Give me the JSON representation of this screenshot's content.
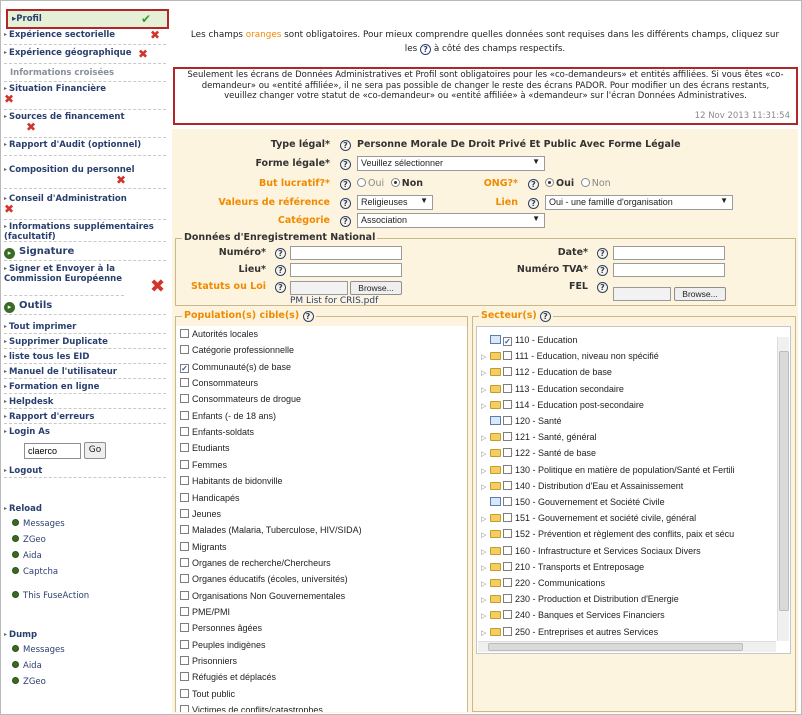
{
  "sidebar": {
    "profil": "Profil",
    "exp_sect": "Expérience sectorielle",
    "exp_geo": "Expérience géographique",
    "info_croisees": "Informations croisées",
    "situation_fin": "Situation Financière",
    "sources_fin": "Sources de financement",
    "rapport_audit": "Rapport d'Audit (optionnel)",
    "composition": "Composition du personnel",
    "conseil": "Conseil d'Administration",
    "info_supp": "Informations supplémentaires (facultatif)",
    "signature": "Signature",
    "signer": "Signer et Envoyer à la Commission Européenne",
    "outils": "Outils",
    "tout_imprimer": "Tout imprimer",
    "supprimer_dup": "Supprimer Duplicate",
    "liste_eid": "liste tous les EID",
    "manuel": "Manuel de l'utilisateur",
    "formation": "Formation en ligne",
    "helpdesk": "Helpdesk",
    "rapport_erreurs": "Rapport d'erreurs",
    "login_as": "Login As",
    "login_value": "claerco",
    "go": "Go",
    "logout": "Logout",
    "reload": "Reload",
    "reload_items": [
      "Messages",
      "ZGeo",
      "Aida",
      "Captcha"
    ],
    "this_fuseaction": "This FuseAction",
    "dump": "Dump",
    "dump_items": [
      "Messages",
      "Aida",
      "ZGeo"
    ]
  },
  "top_info": {
    "pre": "Les champs ",
    "orange": "oranges",
    "post": " sont obligatoires. Pour mieux comprendre quelles données sont requises dans les différents champs, cliquez sur",
    "line2_a": "les",
    "line2_b": "à côté des champs respectifs."
  },
  "warning": {
    "text": "Seulement les écrans de Données Administratives et Profil sont obligatoires pour les «co-demandeurs» et entités affiliées. Si vous êtes «co-demandeur» ou «entité affiliée», il ne sera pas possible de changer le reste des écrans PADOR. Pour modifier un des écrans restants, veuillez changer votre statut de «co-demandeur» ou «entité affiliée» à «demandeur» sur l'écran Données Administratives.",
    "date": "12 Nov 2013 11:31:54"
  },
  "form": {
    "type_legal_label": "Type légal*",
    "type_legal_value": "Personne Morale De Droit Privé Et Public Avec Forme Légale",
    "forme_legale_label": "Forme légale*",
    "forme_legale_value": "Veuillez sélectionner",
    "but_lucratif_label": "But lucratif?*",
    "oui": "Oui",
    "non": "Non",
    "ong_label": "ONG?*",
    "valeurs_label": "Valeurs de référence",
    "valeurs_value": "Religieuses",
    "lien_label": "Lien",
    "lien_value": "Oui - une famille d'organisation",
    "categorie_label": "Catégorie",
    "categorie_value": "Association"
  },
  "enregistrement": {
    "legend": "Données d'Enregistrement National",
    "numero": "Numéro*",
    "date": "Date*",
    "lieu": "Lieu*",
    "tva": "Numéro TVA*",
    "statuts": "Statuts ou Loi",
    "fel": "FEL",
    "browse": "Browse...",
    "file": "PM List for CRIS.pdf"
  },
  "population": {
    "legend": "Population(s) cible(s)",
    "items": [
      {
        "label": "Autorités locales",
        "checked": false
      },
      {
        "label": "Catégorie professionnelle",
        "checked": false
      },
      {
        "label": "Communauté(s) de base",
        "checked": true
      },
      {
        "label": "Consommateurs",
        "checked": false
      },
      {
        "label": "Consommateurs de drogue",
        "checked": false
      },
      {
        "label": "Enfants (- de 18 ans)",
        "checked": false
      },
      {
        "label": "Enfants-soldats",
        "checked": false
      },
      {
        "label": "Etudiants",
        "checked": false
      },
      {
        "label": "Femmes",
        "checked": false
      },
      {
        "label": "Habitants de bidonville",
        "checked": false
      },
      {
        "label": "Handicapés",
        "checked": false
      },
      {
        "label": "Jeunes",
        "checked": false
      },
      {
        "label": "Malades (Malaria, Tuberculose, HIV/SIDA)",
        "checked": false
      },
      {
        "label": "Migrants",
        "checked": false
      },
      {
        "label": "Organes de recherche/Chercheurs",
        "checked": false
      },
      {
        "label": "Organes éducatifs (écoles, universités)",
        "checked": false
      },
      {
        "label": "Organisations Non Gouvernementales",
        "checked": false
      },
      {
        "label": "PME/PMI",
        "checked": false
      },
      {
        "label": "Personnes âgées",
        "checked": false
      },
      {
        "label": "Peuples indigènes",
        "checked": false
      },
      {
        "label": "Prisonniers",
        "checked": false
      },
      {
        "label": "Réfugiés et déplacés",
        "checked": false
      },
      {
        "label": "Tout public",
        "checked": false
      },
      {
        "label": "Victimes de conflits/catastrophes",
        "checked": false
      }
    ]
  },
  "secteur": {
    "legend": "Secteur(s)",
    "items": [
      {
        "label": "110 - Education",
        "checked": true,
        "kind": "leaf"
      },
      {
        "label": "111 - Education, niveau non spécifié",
        "checked": false,
        "kind": "folder"
      },
      {
        "label": "112 - Education de base",
        "checked": false,
        "kind": "folder"
      },
      {
        "label": "113 - Education secondaire",
        "checked": false,
        "kind": "folder"
      },
      {
        "label": "114 - Education post-secondaire",
        "checked": false,
        "kind": "folder"
      },
      {
        "label": "120 - Santé",
        "checked": false,
        "kind": "leaf"
      },
      {
        "label": "121 - Santé, général",
        "checked": false,
        "kind": "folder"
      },
      {
        "label": "122 - Santé de base",
        "checked": false,
        "kind": "folder"
      },
      {
        "label": "130 - Politique en matière de population/Santé et Fertili",
        "checked": false,
        "kind": "folder"
      },
      {
        "label": "140 - Distribution d'Eau et Assainissement",
        "checked": false,
        "kind": "folder"
      },
      {
        "label": "150 - Gouvernement et Société Civile",
        "checked": false,
        "kind": "leaf"
      },
      {
        "label": "151 - Gouvernement et société civile, général",
        "checked": false,
        "kind": "folder"
      },
      {
        "label": "152 - Prévention et règlement des conflits, paix et sécu",
        "checked": false,
        "kind": "folder"
      },
      {
        "label": "160 - Infrastructure et Services Sociaux Divers",
        "checked": false,
        "kind": "folder"
      },
      {
        "label": "210 - Transports et Entreposage",
        "checked": false,
        "kind": "folder"
      },
      {
        "label": "220 - Communications",
        "checked": false,
        "kind": "folder"
      },
      {
        "label": "230 - Production et Distribution d'Energie",
        "checked": false,
        "kind": "folder"
      },
      {
        "label": "240 - Banques et Services Financiers",
        "checked": false,
        "kind": "folder"
      },
      {
        "label": "250 - Entreprises et autres Services",
        "checked": false,
        "kind": "folder"
      }
    ]
  }
}
